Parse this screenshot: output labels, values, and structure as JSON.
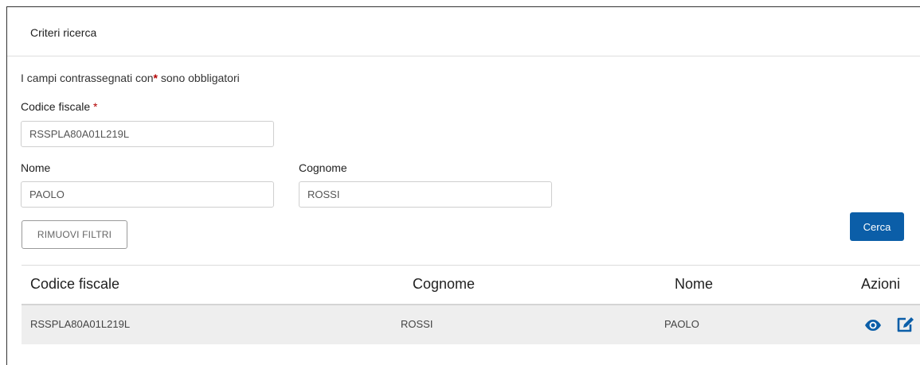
{
  "panel": {
    "title": "Criteri ricerca"
  },
  "form": {
    "required_note": {
      "text": "I campi contrassegnati con",
      "star": "*",
      "suffix": " sono obbligatori"
    },
    "codice_fiscale": {
      "label": "Codice fiscale",
      "star": "*",
      "value": "RSSPLA80A01L219L"
    },
    "nome": {
      "label": "Nome",
      "value": "PAOLO"
    },
    "cognome": {
      "label": "Cognome",
      "value": "ROSSI"
    },
    "reset_label": "RIMUOVI FILTRI",
    "search_label": "Cerca"
  },
  "table": {
    "headers": [
      "Codice fiscale",
      "Cognome",
      "Nome",
      "Azioni"
    ],
    "rows": [
      {
        "codice_fiscale": "RSSPLA80A01L219L",
        "cognome": "ROSSI",
        "nome": "PAOLO",
        "actions": [
          "eye-icon",
          "edit-icon"
        ]
      }
    ]
  },
  "colors": {
    "primary": "#0b5ea8",
    "required": "#b30000",
    "row_bg": "#eeeeee"
  }
}
